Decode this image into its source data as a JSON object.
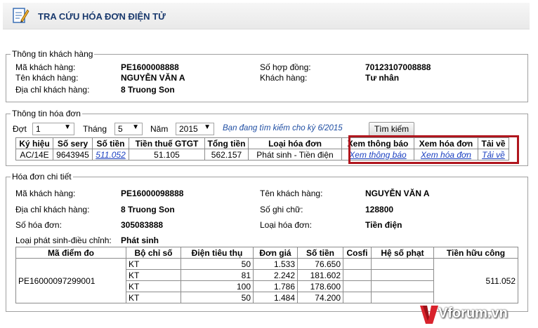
{
  "header": {
    "title": "TRA CỨU HÓA ĐƠN ĐIỆN TỬ"
  },
  "customer": {
    "legend": "Thông tin khách hàng",
    "ma_kh_label": "Mã khách hàng:",
    "ma_kh_value": "PE1600008888",
    "so_hd_label": "Số hợp đồng:",
    "so_hd_value": "70123107008888",
    "ten_kh_label": "Tên khách hàng:",
    "ten_kh_value": "NGUYỄN VĂN A",
    "khach_hang_label": "Khách hàng:",
    "khach_hang_value": "Tư nhân",
    "dia_chi_label": "Địa chỉ khách hàng:",
    "dia_chi_value": "8 Truong Son"
  },
  "invoice_info": {
    "legend": "Thông tin hóa đơn",
    "dot_label": "Đợt",
    "dot_value": "1",
    "thang_label": "Tháng",
    "thang_value": "5",
    "nam_label": "Năm",
    "nam_value": "2015",
    "notice": "Bạn đang tìm kiếm cho kỳ 6/2015",
    "search_button": "Tìm kiếm",
    "columns": [
      "Ký hiệu",
      "Số sery",
      "Số tiền",
      "Tiền thuế GTGT",
      "Tổng tiền",
      "Loại hóa đơn",
      "Xem thông báo",
      "Xem hóa đơn",
      "Tải về"
    ],
    "row": {
      "ky_hieu": "AC/14E",
      "so_sery": "9643945",
      "so_tien": "511.052",
      "tien_thue": "51.105",
      "tong_tien": "562.157",
      "loai": "Phát sinh - Tiền điện",
      "xem_thong_bao": "Xem thông báo",
      "xem_hoa_don": "Xem hóa đơn",
      "tai_ve": "Tải về"
    }
  },
  "detail": {
    "legend": "Hóa đơn chi tiết",
    "ma_kh_label": "Mã khách hàng:",
    "ma_kh_value": "PE16000098888",
    "ten_kh_label": "Tên khách hàng:",
    "ten_kh_value": "NGUYỄN VĂN A",
    "dia_chi_label": "Địa chỉ khách hàng:",
    "dia_chi_value": "8 Truong Son",
    "so_ghi_chu_label": "Số ghi chữ:",
    "so_ghi_chu_value": "128800",
    "so_hoa_don_label": "Số hóa đơn:",
    "so_hoa_don_value": "305083888",
    "loai_hd_label": "Loại hóa đơn:",
    "loai_hd_value": "Tiền điện",
    "loai_ps_label": "Loại phát sinh-điều chỉnh:",
    "loai_ps_value": "Phát sinh",
    "columns": [
      "Mã điểm đo",
      "Bộ chỉ số",
      "Điện tiêu thụ",
      "Đơn giá",
      "Số tiền",
      "Cosfi",
      "Hệ số phạt",
      "Tiền hữu công"
    ],
    "ma_diem_do": "PE16000097299001",
    "tien_huu_cong": "511.052",
    "rows": [
      {
        "bo_chi_so": "KT",
        "dien": "50",
        "don_gia": "1.533",
        "so_tien": "76.650"
      },
      {
        "bo_chi_so": "KT",
        "dien": "81",
        "don_gia": "2.242",
        "so_tien": "181.602"
      },
      {
        "bo_chi_so": "KT",
        "dien": "100",
        "don_gia": "1.786",
        "so_tien": "178.600"
      },
      {
        "bo_chi_so": "KT",
        "dien": "50",
        "don_gia": "1.484",
        "so_tien": "74.200"
      }
    ]
  },
  "watermark": {
    "text": "Vforum.vn"
  }
}
